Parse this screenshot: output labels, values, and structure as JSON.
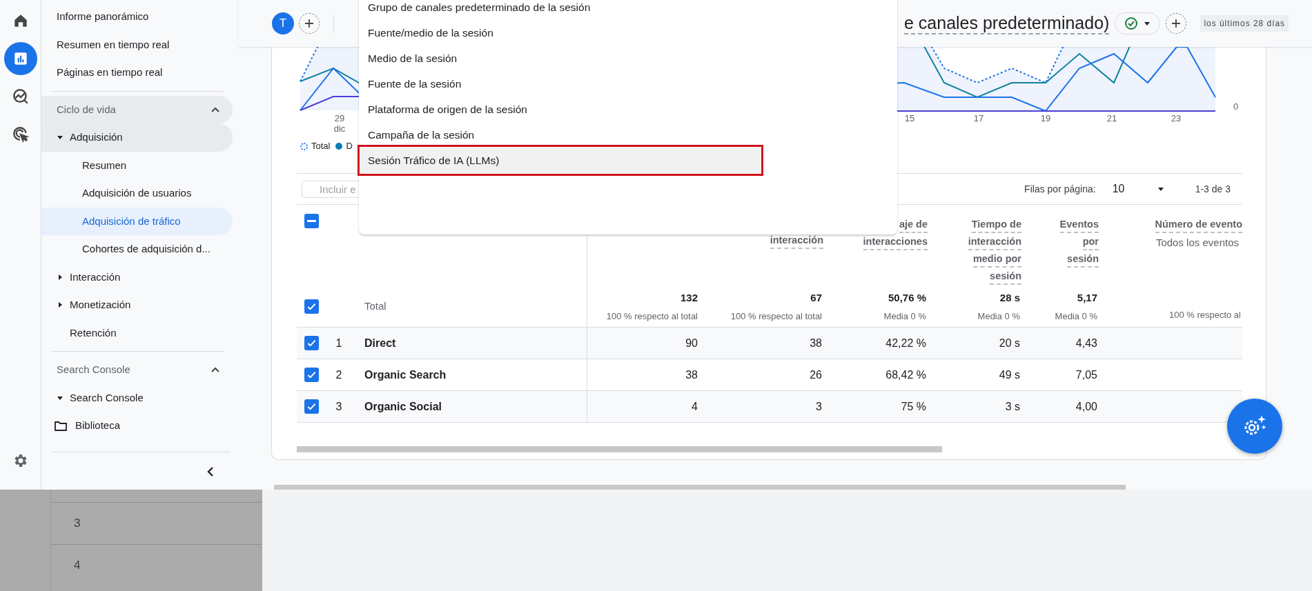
{
  "rail": {
    "items": [
      {
        "kind": "home",
        "selected": false
      },
      {
        "kind": "reports",
        "selected": true
      },
      {
        "kind": "explore",
        "selected": false
      },
      {
        "kind": "advertising",
        "selected": false
      }
    ]
  },
  "nav": {
    "top_links": [
      {
        "label": "Informe panorámico",
        "selected": false
      },
      {
        "label": "Resumen en tiempo real",
        "selected": false
      },
      {
        "label": "Páginas en tiempo real",
        "selected": false
      }
    ],
    "sections": [
      {
        "title": "Ciclo de vida",
        "expanded": true,
        "selected": true,
        "items": [
          {
            "label": "Adquisición",
            "expanded": true,
            "selected": true,
            "children": [
              {
                "label": "Resumen",
                "selected": false
              },
              {
                "label": "Adquisición de usuarios",
                "selected": false
              },
              {
                "label": "Adquisición de tráfico",
                "selected": true
              },
              {
                "label": "Cohortes de adquisición d...",
                "selected": false
              }
            ]
          },
          {
            "label": "Interacción",
            "expanded": false,
            "selected": false
          },
          {
            "label": "Monetización",
            "expanded": false,
            "selected": false
          },
          {
            "label": "Retención",
            "selected": false
          }
        ]
      },
      {
        "title": "Search Console",
        "expanded": true,
        "selected": false,
        "items": [
          {
            "label": "Search Console",
            "expanded": true,
            "selected": false
          }
        ]
      }
    ],
    "library": {
      "label": "Biblioteca",
      "selected": false
    }
  },
  "header": {
    "avatar": "T",
    "title": "e canales predeterminado)",
    "date_range": "los últimos 28 días"
  },
  "chart": {
    "x_labels": [
      {
        "label": "29",
        "sub": "dic"
      },
      {
        "label": "15"
      },
      {
        "label": "17"
      },
      {
        "label": "19"
      },
      {
        "label": "21"
      },
      {
        "label": "23"
      }
    ],
    "y_label": "0",
    "legend": [
      {
        "label": "Total",
        "kind": "total",
        "color": "#1a73e8"
      },
      {
        "label": "D",
        "kind": "series",
        "color": "#0b7db7"
      }
    ]
  },
  "toolbar": {
    "search": {
      "placeholder": "Incluir e"
    },
    "rows_per_page_label": "Filas por página:",
    "rows_per_page": "10",
    "range": "1-3 de 3"
  },
  "dropdown": {
    "items": [
      {
        "label": "Grupo de canales predeterminado de la sesión",
        "selected": false
      },
      {
        "label": "Fuente/medio de la sesión",
        "selected": false
      },
      {
        "label": "Medio de la sesión",
        "selected": false
      },
      {
        "label": "Fuente de la sesión",
        "selected": false
      },
      {
        "label": "Plataforma de origen de la sesión",
        "selected": false
      },
      {
        "label": "Campaña de la sesión",
        "selected": false
      },
      {
        "label": "Sesión Tráfico de IA (LLMs)",
        "selected": true
      }
    ]
  },
  "table": {
    "select_all": {
      "indeterminate": true
    },
    "metric_headers": [
      {
        "lines": [
          "interacción"
        ]
      },
      {
        "lines": [
          "aje de",
          "interacciones"
        ]
      },
      {
        "lines": [
          "Tiempo de",
          "interacción",
          "medio por",
          "sesión"
        ]
      },
      {
        "lines": [
          "Eventos",
          "por",
          "sesión"
        ]
      },
      {
        "lines": [
          "Número de evento"
        ],
        "subtitle": "Todos los eventos"
      }
    ],
    "totals": {
      "label": "Total",
      "checked": true,
      "cells": [
        {
          "value": "132",
          "sub": "100 % respecto al total"
        },
        {
          "value": "67",
          "sub": "100 % respecto al total"
        },
        {
          "value": "50,76 %",
          "sub": "Media 0 %"
        },
        {
          "value": "28 s",
          "sub": "Media 0 %"
        },
        {
          "value": "5,17",
          "sub": "Media 0 %"
        },
        {
          "sub": "100 % respecto al"
        }
      ]
    },
    "rows": [
      {
        "index": "1",
        "name": "Direct",
        "checked": true,
        "values": [
          "90",
          "38",
          "42,22 %",
          "20 s",
          "4,43"
        ]
      },
      {
        "index": "2",
        "name": "Organic Search",
        "checked": true,
        "values": [
          "38",
          "26",
          "68,42 %",
          "49 s",
          "7,05"
        ]
      },
      {
        "index": "3",
        "name": "Organic Social",
        "checked": true,
        "values": [
          "4",
          "3",
          "75 %",
          "3 s",
          "4,00"
        ]
      }
    ]
  },
  "background_sheet": {
    "rows": [
      "3",
      "4"
    ]
  }
}
